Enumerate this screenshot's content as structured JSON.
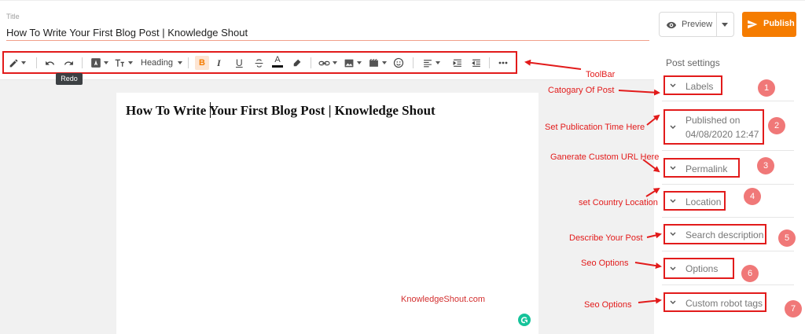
{
  "title_field": {
    "label": "Title",
    "value": "How To Write Your First Blog Post | Knowledge Shout"
  },
  "header": {
    "preview_label": "Preview",
    "publish_label": "Publish"
  },
  "toolbar": {
    "heading_label": "Heading",
    "bold_label": "B",
    "italic_label": "I",
    "underline_label": "U",
    "text_color_label": "A",
    "tooltip": "Redo",
    "icons": [
      "pencil-icon",
      "undo-icon",
      "redo-icon",
      "font-icon",
      "font-size-icon",
      "bold-icon",
      "italic-icon",
      "underline-icon",
      "strikethrough-icon",
      "text-color-icon",
      "highlight-icon",
      "link-icon",
      "image-icon",
      "video-icon",
      "emoji-icon",
      "align-icon",
      "indent-icon",
      "outdent-icon",
      "more-icon"
    ]
  },
  "editor": {
    "content_heading": "How To Write Your First Blog Post | Knowledge Shout",
    "watermark": "KnowledgeShout.com"
  },
  "settings": {
    "title": "Post settings",
    "items": [
      {
        "label": "Labels"
      },
      {
        "label_line1": "Published on",
        "label_line2": "04/08/2020 12:47"
      },
      {
        "label": "Permalink"
      },
      {
        "label": "Location"
      },
      {
        "label": "Search description"
      },
      {
        "label": "Options"
      },
      {
        "label": "Custom robot tags"
      }
    ]
  },
  "annotations": {
    "toolbar": "ToolBar",
    "labels": "Catogary Of Post",
    "published": "Set Publication Time Here",
    "permalink": "Ganerate Custom URL Here",
    "location": "set Country Location",
    "search": "Describe Your Post",
    "options": "Seo Options",
    "robots": "Seo Options",
    "numbers": [
      "1",
      "2",
      "3",
      "4",
      "5",
      "6",
      "7"
    ]
  },
  "colors": {
    "accent_orange": "#f57c00",
    "annotation_red": "#e21b1b",
    "number_badge": "#f07878"
  }
}
